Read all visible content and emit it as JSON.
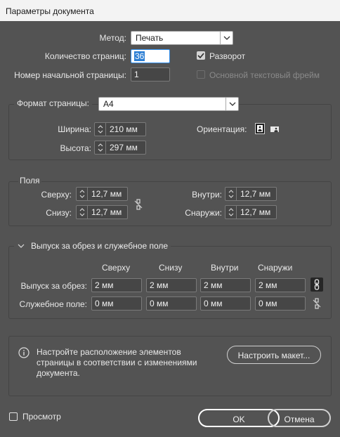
{
  "dialog": {
    "title": "Параметры документа"
  },
  "top": {
    "method_label": "Метод:",
    "method_value": "Печать",
    "pages_label": "Количество страниц:",
    "pages_value": "36",
    "start_label": "Номер начальной страницы:",
    "start_value": "1",
    "facing_label": "Разворот",
    "facing_checked": true,
    "primary_frame_label": "Основной текстовый фрейм",
    "primary_frame_checked": false
  },
  "page_size": {
    "label": "Формат страницы:",
    "value": "A4",
    "width_label": "Ширина:",
    "width_value": "210 мм",
    "height_label": "Высота:",
    "height_value": "297 мм",
    "orientation_label": "Ориентация:",
    "orientation_selected": "portrait"
  },
  "margins": {
    "title": "Поля",
    "top_label": "Сверху:",
    "top_value": "12,7 мм",
    "bottom_label": "Снизу:",
    "bottom_value": "12,7 мм",
    "inside_label": "Внутри:",
    "inside_value": "12,7 мм",
    "outside_label": "Снаружи:",
    "outside_value": "12,7 мм"
  },
  "bleed": {
    "title": "Выпуск за обрез и служебное поле",
    "headers": [
      "Сверху",
      "Снизу",
      "Внутри",
      "Снаружи"
    ],
    "bleed_label": "Выпуск за обрез:",
    "bleed_values": [
      "2 мм",
      "2 мм",
      "2 мм",
      "2 мм"
    ],
    "slug_label": "Служебное поле:",
    "slug_values": [
      "0 мм",
      "0 мм",
      "0 мм",
      "0 мм"
    ]
  },
  "info": {
    "text_lines": [
      "Настройте расположение элементов",
      "страницы в соответствии с изменениями",
      "документа."
    ],
    "adjust_button": "Настроить макет..."
  },
  "footer": {
    "preview_label": "Просмотр",
    "preview_checked": false,
    "ok_label": "OK",
    "cancel_label": "Отмена"
  }
}
